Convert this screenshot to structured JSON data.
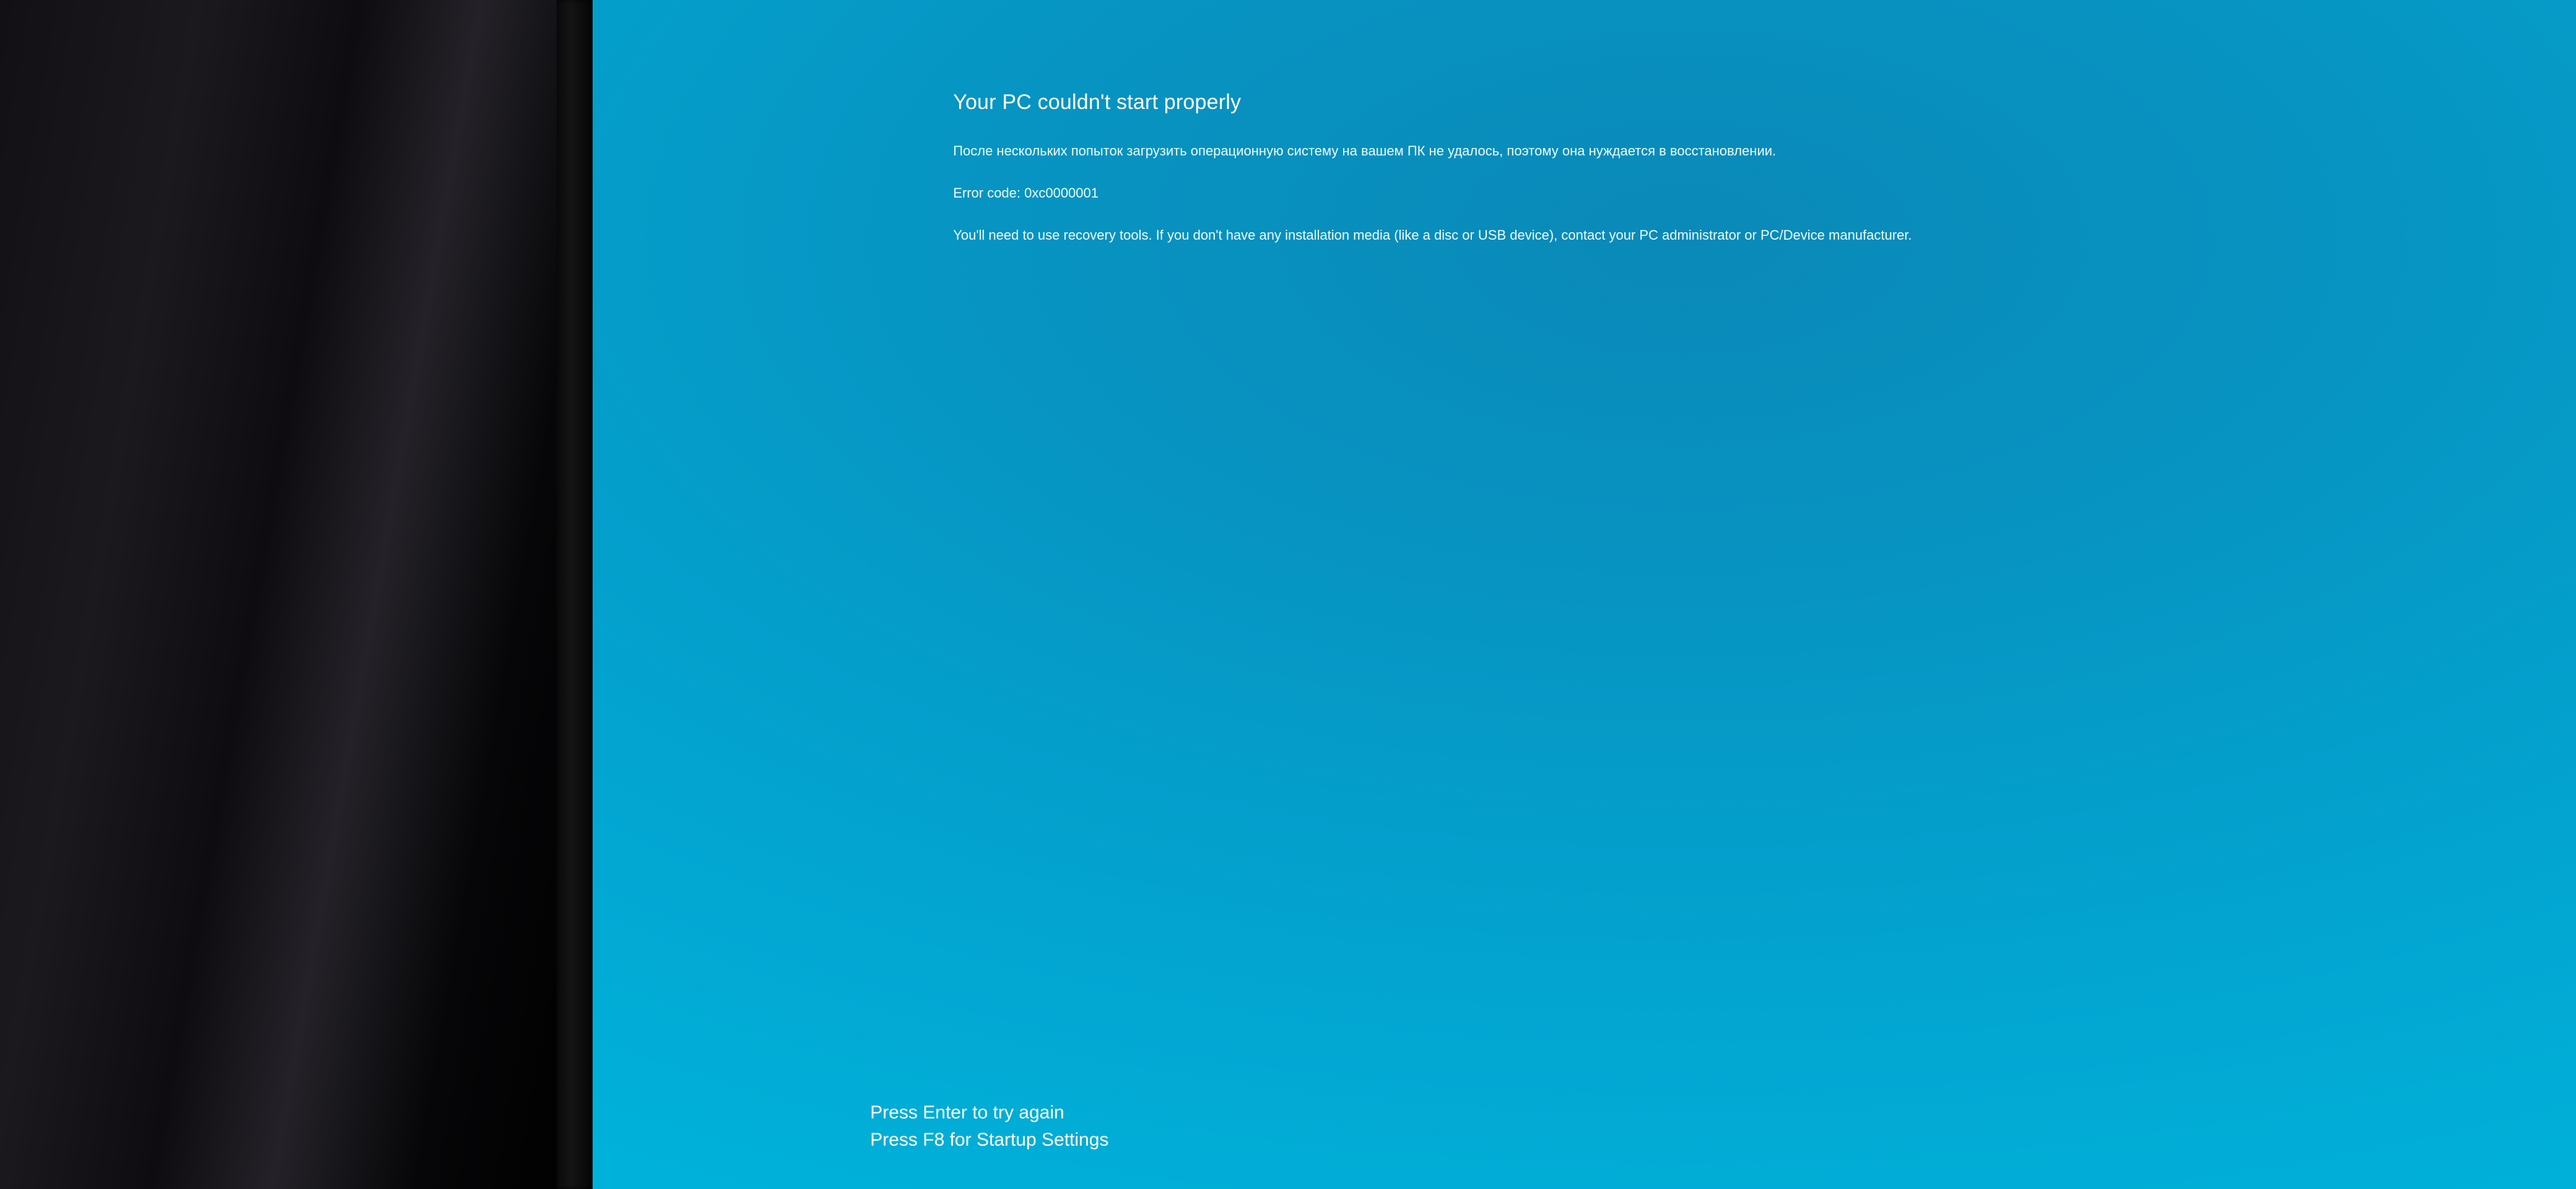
{
  "error_screen": {
    "title": "Your PC couldn't start properly",
    "message_ru": "После нескольких попыток загрузить операционную систему на вашем ПК не удалось, поэтому она нуждается в восстановлении.",
    "error_code_label": "Error code: 0xc0000001",
    "recovery_hint": "You'll need to use recovery tools. If you don't have any installation media (like a disc or USB device), contact your PC administrator or PC/Device manufacturer.",
    "prompt_enter": "Press Enter to try again",
    "prompt_f8": "Press F8 for Startup Settings"
  }
}
